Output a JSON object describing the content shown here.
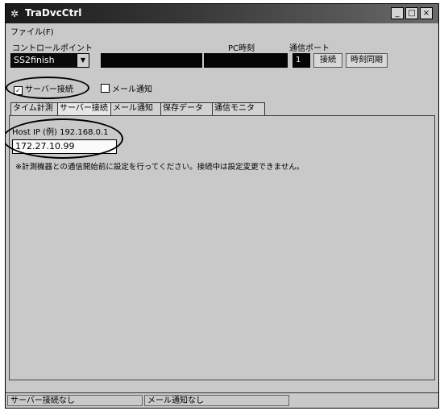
{
  "window": {
    "title": "TraDvcCtrl",
    "app_icon": "settings-icon",
    "controls": {
      "minimize": "_",
      "maximize": "□",
      "close": "×"
    }
  },
  "menu": {
    "file": "ファイル(F)"
  },
  "labels": {
    "control_point": "コントロールポイント",
    "pc_time": "PC時刻",
    "comm_port": "通信ポート"
  },
  "control_point": {
    "selected": "SS2finish"
  },
  "comm_port": {
    "value": "1"
  },
  "buttons": {
    "connect": "接続",
    "time_sync": "時刻同期"
  },
  "options": {
    "server_connect": "サーバー接続",
    "mail_notify": "メール通知"
  },
  "tabs": [
    {
      "label": "タイム計測"
    },
    {
      "label": "サーバー接続"
    },
    {
      "label": "メール通知"
    },
    {
      "label": "保存データ"
    },
    {
      "label": "通信モニタ"
    }
  ],
  "server_tab": {
    "host_label": "Host IP (例) 192.168.0.1",
    "host_value": "172.27.10.99",
    "note": "※計測機器との通信開始前に設定を行ってください。接続中は設定変更できません。"
  },
  "status": {
    "server": "サーバー接続なし",
    "mail": "メール通知なし"
  }
}
